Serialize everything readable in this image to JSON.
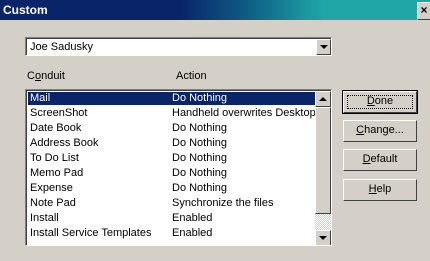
{
  "window": {
    "title": "Custom",
    "close_glyph": "×"
  },
  "user_select": {
    "value": "Joe Sadusky"
  },
  "columns": {
    "conduit_pre": "C",
    "conduit_ul": "o",
    "conduit_post": "nduit",
    "action": "Action"
  },
  "rows": [
    {
      "conduit": "Mail",
      "action": "Do Nothing",
      "selected": true
    },
    {
      "conduit": "ScreenShot",
      "action": "Handheld overwrites Desktop"
    },
    {
      "conduit": "Date Book",
      "action": "Do Nothing"
    },
    {
      "conduit": "Address Book",
      "action": "Do Nothing"
    },
    {
      "conduit": "To Do List",
      "action": "Do Nothing"
    },
    {
      "conduit": "Memo Pad",
      "action": "Do Nothing"
    },
    {
      "conduit": "Expense",
      "action": "Do Nothing"
    },
    {
      "conduit": "Note Pad",
      "action": "Synchronize the files"
    },
    {
      "conduit": "Install",
      "action": "Enabled"
    },
    {
      "conduit": "Install Service Templates",
      "action": "Enabled"
    }
  ],
  "buttons": {
    "done": {
      "ul": "D",
      "rest": "one"
    },
    "change": {
      "ul": "C",
      "rest": "hange..."
    },
    "default": {
      "ul": "D",
      "rest": "efault"
    },
    "help": {
      "ul": "H",
      "rest": "elp"
    }
  },
  "colors": {
    "selection": "#0a246a",
    "face": "#d4d0c8"
  }
}
